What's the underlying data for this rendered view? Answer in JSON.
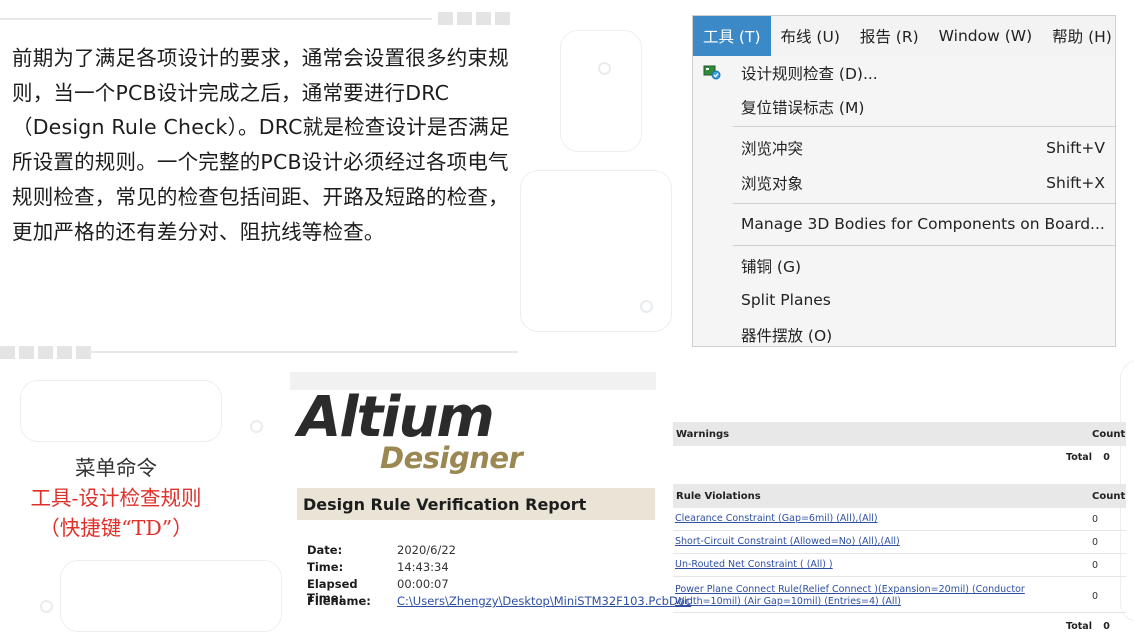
{
  "intro": {
    "text": "前期为了满足各项设计的要求，通常会设置很多约束规则，当一个PCB设计完成之后，通常要进行DRC（Design Rule Check）。DRC就是检查设计是否满足所设置的规则。一个完整的PCB设计必须经过各项电气规则检查，常见的检查包括间距、开路及短路的检查，更加严格的还有差分对、阻抗线等检查。"
  },
  "menu": {
    "bar": [
      {
        "label": "工具 (T)",
        "active": true
      },
      {
        "label": "布线 (U)",
        "active": false
      },
      {
        "label": "报告 (R)",
        "active": false
      },
      {
        "label": "Window (W)",
        "active": false
      },
      {
        "label": "帮助 (H)",
        "active": false
      }
    ],
    "items": [
      {
        "label": "设计规则检查 (D)...",
        "shortcut": ""
      },
      {
        "label": "复位错误标志 (M)",
        "shortcut": ""
      },
      {
        "label": "浏览冲突",
        "shortcut": "Shift+V"
      },
      {
        "label": "浏览对象",
        "shortcut": "Shift+X"
      },
      {
        "label": "Manage 3D Bodies for Components on Board...",
        "shortcut": ""
      },
      {
        "label": "铺铜 (G)",
        "shortcut": ""
      },
      {
        "label": "Split Planes",
        "shortcut": ""
      },
      {
        "label": "器件摆放 (O)",
        "shortcut": ""
      }
    ]
  },
  "caption": {
    "line1": "菜单命令",
    "line2": "工具-设计检查规则",
    "line3": "（快捷键“TD”）"
  },
  "report": {
    "logo_line1": "Altium",
    "logo_line2": "Designer",
    "title": "Design Rule Verification Report",
    "info": [
      {
        "key": "Date:",
        "value": "2020/6/22"
      },
      {
        "key": "Time:",
        "value": "14:43:34"
      },
      {
        "key": "Elapsed Time:",
        "value": "00:00:07"
      },
      {
        "key": "Filename:",
        "value": "C:\\Users\\Zhengzy\\Desktop\\MiniSTM32F103.PcbDoc"
      }
    ],
    "warnings_header": "Warnings",
    "count_header": "Count",
    "total_label": "Total",
    "warnings_total": "0",
    "violations_header": "Rule Violations",
    "violations": [
      {
        "rule": "Clearance Constraint (Gap=6mil) (All),(All)",
        "count": "0"
      },
      {
        "rule": "Short-Circuit Constraint (Allowed=No) (All),(All)",
        "count": "0"
      },
      {
        "rule": "Un-Routed Net Constraint ( (All) )",
        "count": "0"
      },
      {
        "rule": "Power Plane Connect Rule(Relief Connect )(Expansion=20mil) (Conductor Width=10mil) (Air Gap=10mil) (Entries=4) (All)",
        "count": "0"
      }
    ],
    "violations_total": "0"
  }
}
